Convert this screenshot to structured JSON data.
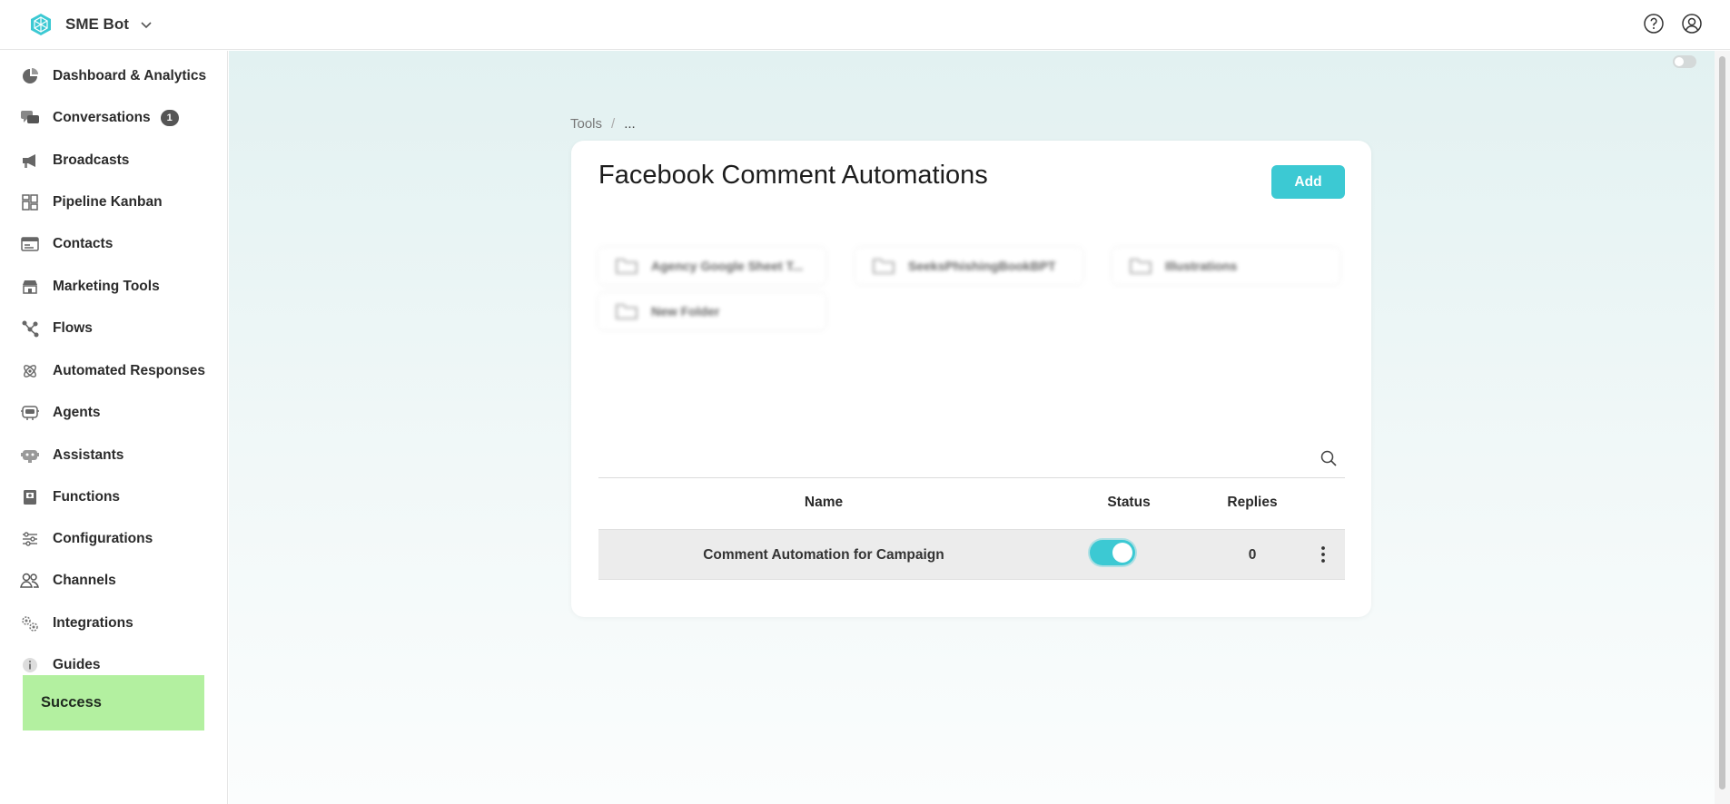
{
  "app": {
    "name": "SME Bot"
  },
  "sidebar": {
    "items": [
      {
        "label": "Dashboard & Analytics",
        "icon": "pie-chart-icon"
      },
      {
        "label": "Conversations",
        "icon": "chat-bubbles-icon",
        "badge": "1"
      },
      {
        "label": "Broadcasts",
        "icon": "megaphone-icon"
      },
      {
        "label": "Pipeline Kanban",
        "icon": "kanban-icon"
      },
      {
        "label": "Contacts",
        "icon": "contact-card-icon"
      },
      {
        "label": "Marketing Tools",
        "icon": "store-icon"
      },
      {
        "label": "Flows",
        "icon": "flow-nodes-icon"
      },
      {
        "label": "Automated Responses",
        "icon": "atom-icon"
      },
      {
        "label": "Agents",
        "icon": "agent-icon"
      },
      {
        "label": "Assistants",
        "icon": "robot-icon"
      },
      {
        "label": "Functions",
        "icon": "function-book-icon"
      },
      {
        "label": "Configurations",
        "icon": "sliders-icon"
      },
      {
        "label": "Channels",
        "icon": "users-icon"
      },
      {
        "label": "Integrations",
        "icon": "gears-icon"
      },
      {
        "label": "Guides",
        "icon": "info-icon"
      }
    ]
  },
  "toast": {
    "text": "Success",
    "color": "#b3f0a0"
  },
  "breadcrumb": {
    "root": "Tools",
    "separator": "/",
    "current": "..."
  },
  "page": {
    "title": "Facebook Comment Automations",
    "add_label": "Add",
    "accent": "#3cc9d3"
  },
  "folders": [
    {
      "name": "Agency Google Sheet T..."
    },
    {
      "name": "SeeksPhishingBookBPT"
    },
    {
      "name": "Illustrations"
    },
    {
      "name": "New Folder"
    }
  ],
  "table": {
    "columns": {
      "name": "Name",
      "status": "Status",
      "replies": "Replies"
    },
    "rows": [
      {
        "name": "Comment Automation for Campaign",
        "status": true,
        "replies": "0"
      }
    ]
  }
}
